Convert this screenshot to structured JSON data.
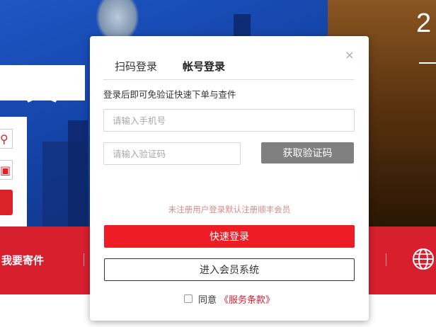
{
  "background": {
    "hero_number": "2",
    "banner_text": "天",
    "nav": {
      "send_label": "我要寄件"
    },
    "icons": {
      "search": "search-icon",
      "package": "package-icon",
      "globe": "globe-icon"
    },
    "colors": {
      "blue": "#1e56c4",
      "brown": "#8a5622",
      "red": "#d71f2e"
    }
  },
  "login": {
    "tabs": [
      {
        "label": "扫码登录",
        "active": false
      },
      {
        "label": "帐号登录",
        "active": true
      }
    ],
    "close_icon": "×",
    "hint": "登录后即可免验证快速下单与查件",
    "phone": {
      "value": "",
      "placeholder": "请输入手机号"
    },
    "code": {
      "value": "",
      "placeholder": "请输入验证码"
    },
    "get_code_label": "获取验证码",
    "notice": "未注册用户登录默认注册顺丰会员",
    "quick_login_label": "快速登录",
    "member_system_label": "进入会员系统",
    "agree": {
      "checked": false,
      "text": "同意",
      "link": "《服务条款》"
    },
    "colors": {
      "primary": "#ee1c24",
      "disabled_button": "#808080",
      "notice": "#d98a8f"
    }
  }
}
